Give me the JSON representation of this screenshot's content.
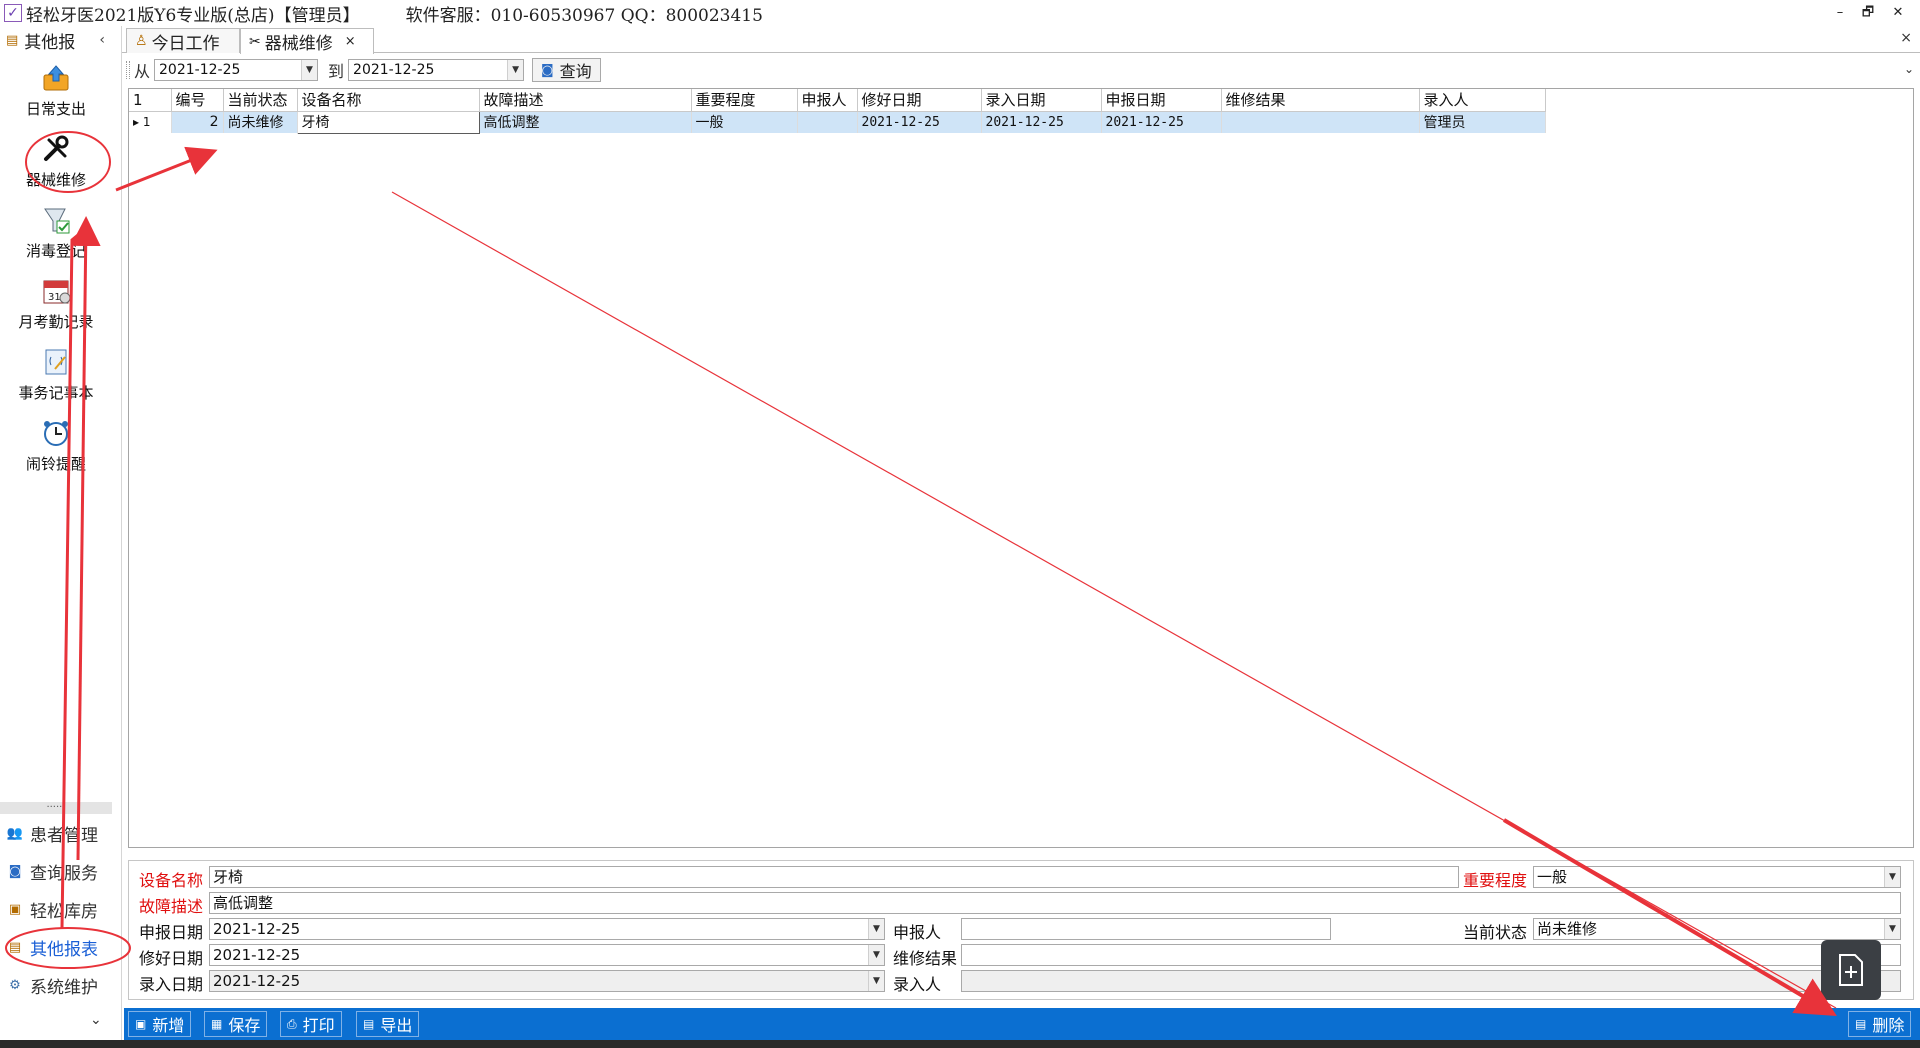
{
  "window": {
    "title": "轻松牙医2021版Y6专业版(总店)【管理员】",
    "support": "软件客服：010-60530967 QQ：800023415",
    "controls": [
      "–",
      "🗗",
      "✕"
    ]
  },
  "sidebar": {
    "header": "其他报",
    "header_chevron": "‹",
    "tools": [
      {
        "label": "日常支出",
        "icon": "upload-box-icon"
      },
      {
        "label": "器械维修",
        "icon": "tools-icon"
      },
      {
        "label": "消毒登记",
        "icon": "disinfect-icon"
      },
      {
        "label": "月考勤记录",
        "icon": "calendar-icon"
      },
      {
        "label": "事务记事本",
        "icon": "notepad-icon"
      },
      {
        "label": "闹铃提醒",
        "icon": "alarm-clock-icon"
      }
    ],
    "dots": "......",
    "nav": [
      {
        "label": "患者管理",
        "icon": "patients-icon"
      },
      {
        "label": "查询服务",
        "icon": "search-service-icon"
      },
      {
        "label": "轻松库房",
        "icon": "warehouse-icon"
      },
      {
        "label": "其他报表",
        "icon": "reports-icon"
      },
      {
        "label": "系统维护",
        "icon": "maintenance-icon"
      }
    ],
    "bottom_chevron": "⌄"
  },
  "tabs": [
    {
      "label": "今日工作",
      "icon": "today-work-icon"
    },
    {
      "label": "器械维修",
      "icon": "tools-icon",
      "close": "×"
    }
  ],
  "tabstrip_close": "×",
  "filter": {
    "from_label": "从",
    "from_value": "2021-12-25",
    "to_label": "到",
    "to_value": "2021-12-25",
    "query_label": "查询"
  },
  "grid": {
    "corner": "1",
    "columns": [
      "编号",
      "当前状态",
      "设备名称",
      "故障描述",
      "重要程度",
      "申报人",
      "修好日期",
      "录入日期",
      "申报日期",
      "维修结果",
      "录入人"
    ],
    "rows": [
      {
        "indicator": "▸ 1",
        "cells": [
          "2",
          "尚未维修",
          "牙椅",
          "高低调整",
          "一般",
          "",
          "2021-12-25",
          "2021-12-25",
          "2021-12-25",
          "",
          "管理员"
        ]
      }
    ]
  },
  "form": {
    "device_label": "设备名称",
    "device_value": "牙椅",
    "importance_label": "重要程度",
    "importance_value": "一般",
    "fault_label": "故障描述",
    "fault_value": "高低调整",
    "report_date_label": "申报日期",
    "report_date_value": "2021-12-25",
    "reporter_label": "申报人",
    "reporter_value": "",
    "status_label": "当前状态",
    "status_value": "尚未维修",
    "fixed_date_label": "修好日期",
    "fixed_date_value": "2021-12-25",
    "result_label": "维修结果",
    "result_value": "",
    "entry_date_label": "录入日期",
    "entry_date_value": "2021-12-25",
    "entry_person_label": "录入人",
    "entry_person_value": ""
  },
  "toolbar": {
    "add": "新增",
    "save": "保存",
    "print": "打印",
    "export": "导出",
    "delete": "删除"
  },
  "colors": {
    "toolbar": "#0b6fd1",
    "selected_row": "#cfe4f7",
    "required": "#e01010",
    "annotation": "#e8333a"
  }
}
